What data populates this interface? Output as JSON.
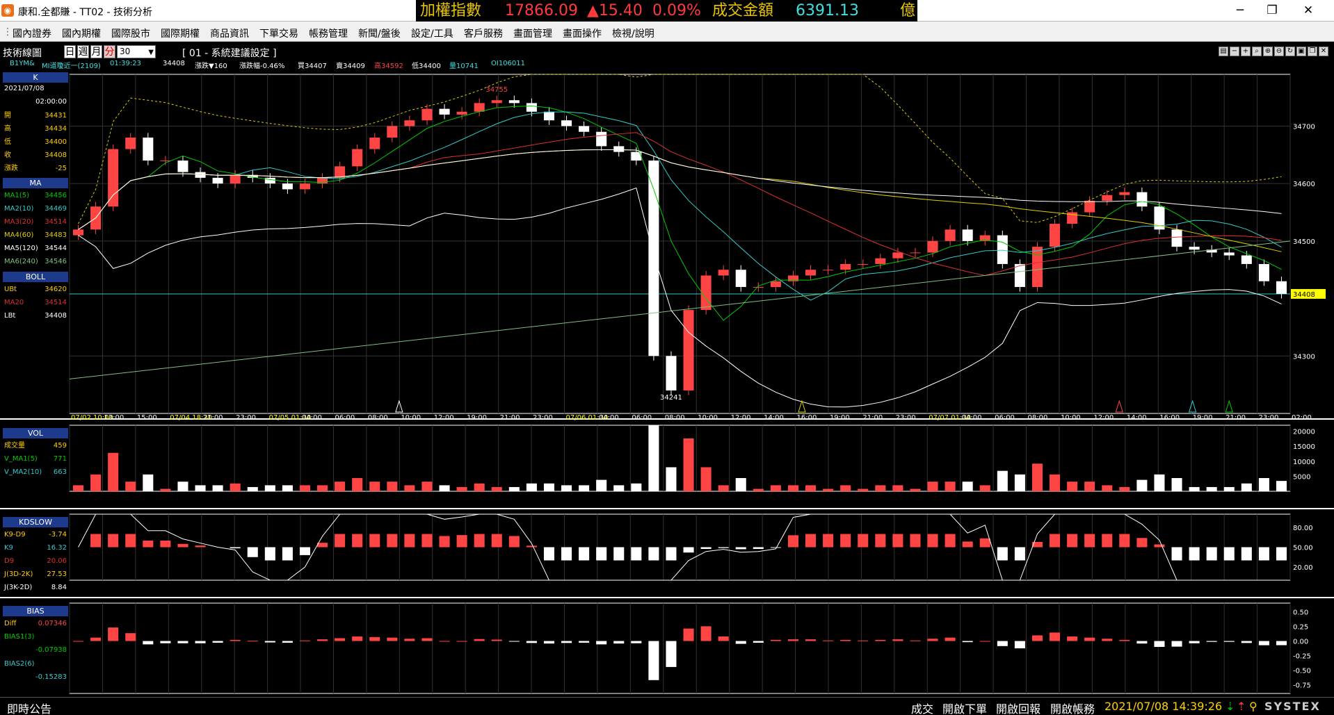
{
  "window": {
    "title": "康和.全都賺 - TT02 - 技術分析",
    "app_icon": "app-logo-icon"
  },
  "ticker": {
    "index_label": "加權指數",
    "index_value": "17866.09",
    "change": "▲15.40",
    "change_pct": "0.09%",
    "turnover_label": "成交金額",
    "turnover_value": "6391.13",
    "unit": "億"
  },
  "window_controls": {
    "minimize": "─",
    "maximize": "❐",
    "close": "✕"
  },
  "menu": [
    "國內證券",
    "國內期權",
    "國際股市",
    "國際期權",
    "商品資訊",
    "下單交易",
    "帳務管理",
    "新聞/盤後",
    "設定/工具",
    "客戶服務",
    "畫面管理",
    "畫面操作",
    "檢視/說明"
  ],
  "toolbar": {
    "title": "技術線圖",
    "periods": [
      "日",
      "週",
      "月",
      "分"
    ],
    "active_period": "分",
    "interval": "30",
    "strategy": "[ 01 - 系統建議設定 ]"
  },
  "quote": {
    "symbol": "B1YM&",
    "name": "MI道瓊近一(2109)",
    "time": "01:39:23",
    "price": "34408",
    "chg_label": "漲跌▼160",
    "pct_label": "漲跌幅-0.46%",
    "bid": "買34407",
    "ask": "賣34409",
    "high": "高34592",
    "low": "低34400",
    "vol": "量10741",
    "oi": "OI106011"
  },
  "panels": {
    "k": {
      "header": "K",
      "date": "2021/07/08",
      "time": "02:00:00",
      "rows": [
        {
          "l": "開",
          "v": "34431"
        },
        {
          "l": "高",
          "v": "34434"
        },
        {
          "l": "低",
          "v": "34400"
        },
        {
          "l": "收",
          "v": "34408"
        },
        {
          "l": "漲跌",
          "v": "-25"
        }
      ]
    },
    "ma": {
      "header": "MA",
      "rows": [
        {
          "l": "MA1(5)",
          "v": "34456"
        },
        {
          "l": "MA2(10)",
          "v": "34469"
        },
        {
          "l": "MA3(20)",
          "v": "34514"
        },
        {
          "l": "MA4(60)",
          "v": "34483"
        },
        {
          "l": "MA5(120)",
          "v": "34544"
        },
        {
          "l": "MA6(240)",
          "v": "34546"
        }
      ]
    },
    "boll": {
      "header": "BOLL",
      "rows": [
        {
          "l": "UBt",
          "v": "34620"
        },
        {
          "l": "MA20",
          "v": "34514"
        },
        {
          "l": "LBt",
          "v": "34408"
        }
      ]
    },
    "vol": {
      "header": "VOL",
      "rows": [
        {
          "l": "成交量",
          "v": "459"
        },
        {
          "l": "V_MA1(5)",
          "v": "771"
        },
        {
          "l": "V_MA2(10)",
          "v": "663"
        }
      ]
    },
    "kd": {
      "header": "KDSLOW",
      "rows": [
        {
          "l": "K9-D9",
          "v": "-3.74"
        },
        {
          "l": "K9",
          "v": "16.32"
        },
        {
          "l": "D9",
          "v": "20.06"
        },
        {
          "l": "J(3D-2K)",
          "v": "27.53"
        },
        {
          "l": "J(3K-2D)",
          "v": "8.84"
        }
      ]
    },
    "bias": {
      "header": "BIAS",
      "rows": [
        {
          "l": "Diff",
          "v": "0.07346"
        },
        {
          "l": "BIAS1(3)",
          "v": ""
        },
        {
          "l": "",
          "v": "-0.07938"
        },
        {
          "l": "BIAS2(6)",
          "v": ""
        },
        {
          "l": "",
          "v": "-0.15283"
        }
      ]
    }
  },
  "colors": {
    "up": "#ff4444",
    "down": "#ffffff",
    "ma5": "#00cc00",
    "ma10": "#33cccc",
    "ma20": "#e03030",
    "ma60": "#e0d000",
    "ma120": "#ffffff",
    "ma240": "#80c080",
    "panel_header": "#1e3a8c",
    "price_label": "#ffff00"
  },
  "chart_data": {
    "type": "candlestick",
    "y_ticks": [
      "34700",
      "34600",
      "34500",
      "34300"
    ],
    "ylim": [
      34200,
      34790
    ],
    "x_ticks": [
      "07/02 10:00",
      "13:00",
      "15:00",
      "07/04 18:30",
      "21:00",
      "23:00",
      "07/05 01:30",
      "04:00",
      "06:00",
      "08:00",
      "10:00",
      "12:00",
      "19:00",
      "21:00",
      "23:00",
      "07/06 01:30",
      "04:00",
      "06:00",
      "08:00",
      "10:00",
      "12:00",
      "14:00",
      "16:00",
      "19:00",
      "21:00",
      "23:00",
      "07/07 01:30",
      "04:00",
      "06:00",
      "08:00",
      "10:00",
      "12:00",
      "14:00",
      "16:00",
      "19:00",
      "21:00",
      "23:00",
      "02:00"
    ],
    "high_label": "34755",
    "low_label": "34241",
    "last_price": "34408",
    "close_series": [
      34520,
      34560,
      34660,
      34680,
      34640,
      34640,
      34620,
      34610,
      34600,
      34615,
      34610,
      34600,
      34590,
      34600,
      34610,
      34630,
      34660,
      34680,
      34700,
      34710,
      34730,
      34720,
      34725,
      34740,
      34745,
      34740,
      34725,
      34710,
      34700,
      34690,
      34665,
      34655,
      34640,
      34300,
      34240,
      34380,
      34440,
      34450,
      34420,
      34420,
      34430,
      34440,
      34450,
      34450,
      34460,
      34460,
      34470,
      34480,
      34480,
      34500,
      34520,
      34500,
      34510,
      34460,
      34420,
      34490,
      34530,
      34550,
      34570,
      34580,
      34585,
      34560,
      34520,
      34490,
      34485,
      34480,
      34475,
      34460,
      34430,
      34408
    ],
    "vol_ticks": [
      "20000",
      "15000",
      "10000",
      "5000"
    ],
    "kd_ticks": [
      "80.00",
      "50.00",
      "20.00"
    ],
    "bias_ticks": [
      "0.50",
      "0.25",
      "0.00",
      "-0.25",
      "-0.50",
      "-0.75"
    ]
  },
  "status": {
    "bulletin": "即時公告",
    "items": [
      "成交",
      "開啟下單",
      "開啟回報",
      "開啟帳務"
    ],
    "datetime": "2021/07/08 14:39:26",
    "brand": "SYSTEX"
  }
}
